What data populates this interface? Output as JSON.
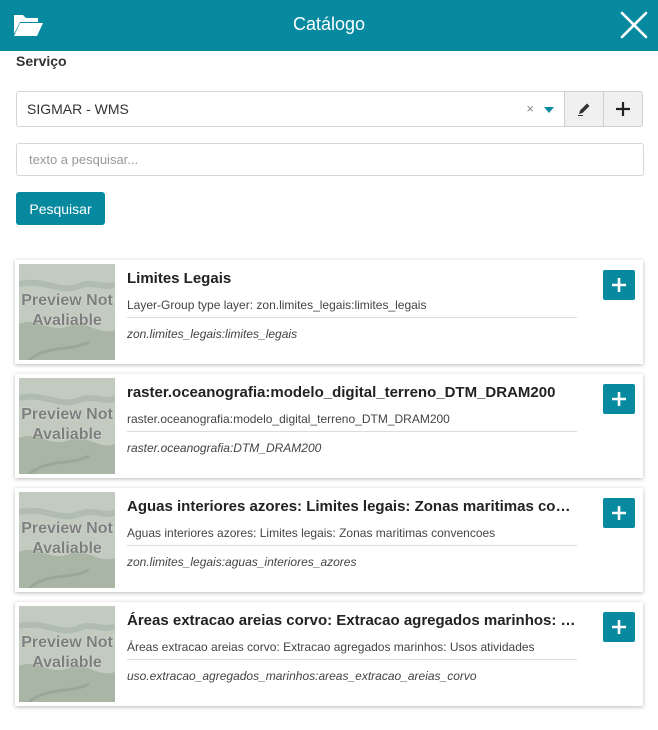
{
  "header": {
    "title": "Catálogo",
    "open_icon": "folder-open-icon",
    "close_icon": "close-icon"
  },
  "service": {
    "label": "Serviço",
    "selected": "SIGMAR - WMS",
    "clear_symbol": "×"
  },
  "search": {
    "placeholder": "texto a pesquisar...",
    "value": "",
    "button_label": "Pesquisar"
  },
  "results": [
    {
      "title": "Limites Legais",
      "description": "Layer-Group type layer: zon.limites_legais:limites_legais",
      "name": "zon.limites_legais:limites_legais",
      "preview_text": "Preview Not Avaliable"
    },
    {
      "title": "raster.oceanografia:modelo_digital_terreno_DTM_DRAM200",
      "description": "raster.oceanografia:modelo_digital_terreno_DTM_DRAM200",
      "name": "raster.oceanografia:DTM_DRAM200",
      "preview_text": "Preview Not Avaliable"
    },
    {
      "title": "Aguas interiores azores: Limites legais: Zonas maritimas convencoes",
      "description": "Aguas interiores azores: Limites legais: Zonas maritimas convencoes",
      "name": "zon.limites_legais:aguas_interiores_azores",
      "preview_text": "Preview Not Avaliable"
    },
    {
      "title": "Áreas extracao areias corvo: Extracao agregados marinhos: Usos atividades",
      "description": "Áreas extracao areias corvo: Extracao agregados marinhos: Usos atividades",
      "name": "uso.extracao_agregados_marinhos:areas_extracao_areias_corvo",
      "preview_text": "Preview Not Avaliable"
    }
  ],
  "colors": {
    "accent": "#078aa0",
    "white": "#ffffff"
  }
}
